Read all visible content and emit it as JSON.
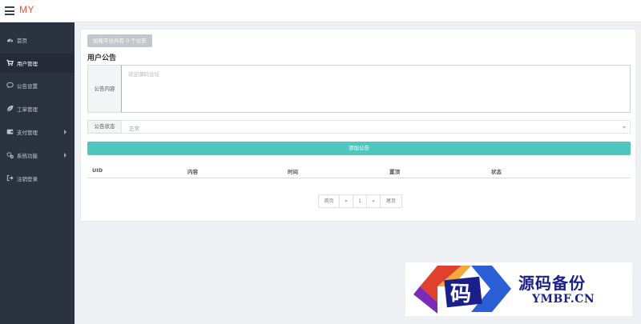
{
  "app": {
    "brand": "MY"
  },
  "sidebar": {
    "items": [
      {
        "label": "首页",
        "icon": "dashboard-icon",
        "has_children": false
      },
      {
        "label": "用户管理",
        "icon": "cart-icon",
        "has_children": false,
        "active": true
      },
      {
        "label": "公告设置",
        "icon": "comment-icon",
        "has_children": false
      },
      {
        "label": "工单管理",
        "icon": "leaf-icon",
        "has_children": false
      },
      {
        "label": "支付管理",
        "icon": "wallet-icon",
        "has_children": true
      },
      {
        "label": "系统功能",
        "icon": "cogs-icon",
        "has_children": true
      },
      {
        "label": "注销登录",
        "icon": "sign-out-icon",
        "has_children": false
      }
    ]
  },
  "main": {
    "badge": "加载平台共有 0 个公告",
    "title": "用户公告",
    "content_label": "公告内容",
    "content_placeholder": "欢迎源码论坛",
    "status_label": "公告状态",
    "status_value": "正常",
    "add_button": "添加公告",
    "table": {
      "columns": [
        "UID",
        "内容",
        "时间",
        "置顶",
        "状态"
      ],
      "rows": []
    },
    "pagination": {
      "first": "首页",
      "prev": "«",
      "current": "1",
      "next": "»",
      "last": "尾页"
    }
  },
  "watermark": {
    "logo_char": "码",
    "title": "源码备份",
    "subtitle": "YMBF.CN"
  },
  "colors": {
    "brand": "#e8553e",
    "sidebar_bg": "#2b3340",
    "accent_button": "#4ec7c0",
    "watermark_text": "#1a1f8a"
  }
}
